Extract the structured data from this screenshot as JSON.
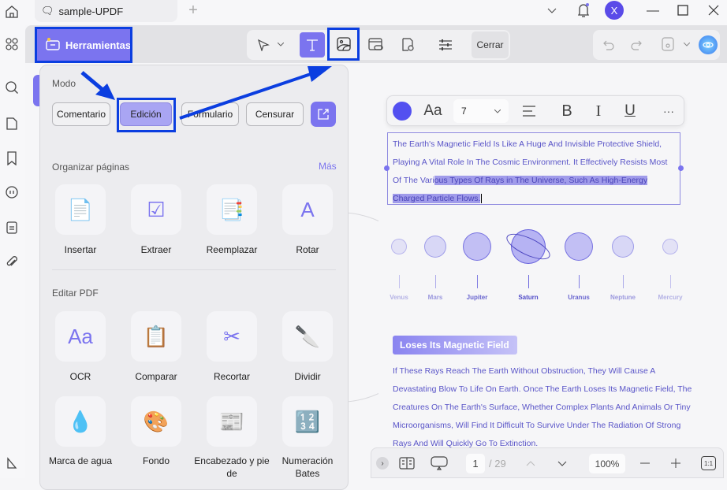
{
  "window": {
    "tab_title": "sample-UPDF",
    "new_tab": "+",
    "avatar_initial": "X"
  },
  "toolbar": {
    "tools_label": "Herramientas",
    "close_label": "Cerrar"
  },
  "tools_panel": {
    "mode_label": "Modo",
    "modes": [
      "Comentario",
      "Edición",
      "Formulario",
      "Censurar"
    ],
    "active_mode": "Edición",
    "organize": {
      "title": "Organizar páginas",
      "more": "Más",
      "items": [
        "Insertar",
        "Extraer",
        "Reemplazar",
        "Rotar"
      ]
    },
    "edit": {
      "title": "Editar PDF",
      "items": [
        "OCR",
        "Comparar",
        "Recortar",
        "Dividir"
      ],
      "items2": [
        "Marca de agua",
        "Fondo",
        "Encabezado y pie de",
        "Numeración Bates"
      ]
    }
  },
  "format_toolbar": {
    "font_size": "7",
    "color": "#5350f0"
  },
  "document": {
    "text_normal": "The Earth's Magnetic Field Is Like A Huge And Invisible Protective Shield, Playing A Vital Role In The Cosmic Environment. It Effectively Resists Most Of The Vari",
    "text_selected": "ous Types Of Rays in The Universe, Such As High-Energy Charged Particle Flows.",
    "planets": [
      "Venus",
      "Mars",
      "Jupiter",
      "Saturn",
      "Uranus",
      "Neptune",
      "Mercury"
    ],
    "heading": "Loses Its Magnetic Field",
    "paragraph": "If These Rays Reach The Earth Without Obstruction, They Will Cause A Devastating Blow To Life On Earth. Once The Earth Loses Its Magnetic Field, The Creatures On The Earth's Surface, Whether Complex Plants And Animals Or Tiny Microorganisms, Will Find It Difficult To Survive Under The Radiation Of Strong Rays And Will Quickly Go To Extinction."
  },
  "bottom": {
    "page": "1",
    "total": "/ 29",
    "zoom": "100%",
    "fit": "1:1"
  },
  "colors": {
    "accent": "#7b74ef",
    "highlight_outline": "#0b3ee0",
    "doc_text": "#5a55c8"
  }
}
